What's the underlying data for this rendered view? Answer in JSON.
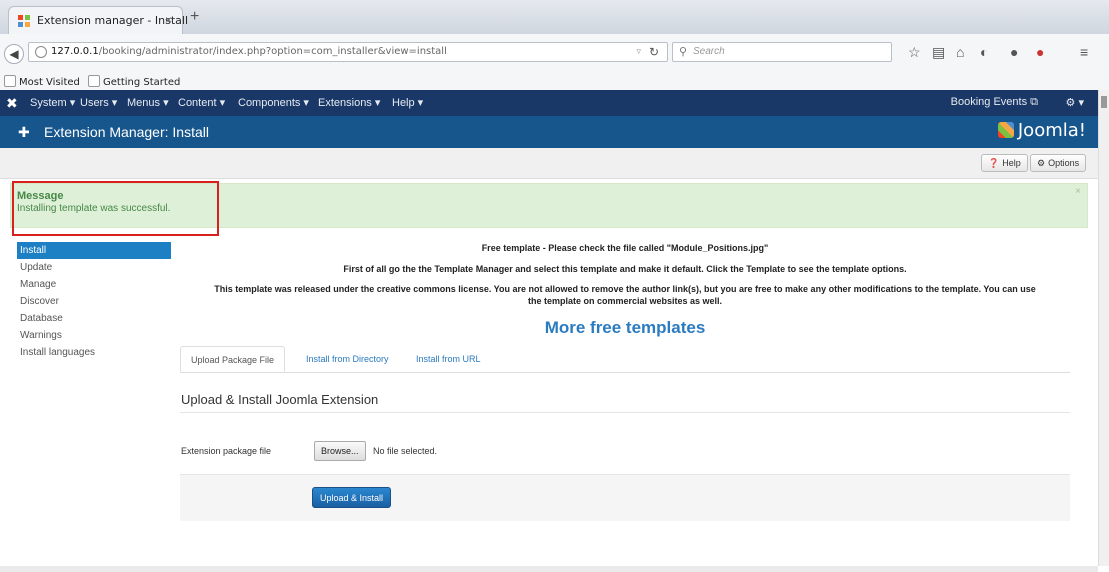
{
  "browser": {
    "tab_title": "Extension manager - Install",
    "tab_close": "×",
    "new_tab": "+",
    "url_host": "127.0.0.1",
    "url_path": "/booking/administrator/index.php?option=com_installer&view=install",
    "search_placeholder": "Search",
    "bookmarks": [
      "Most Visited",
      "Getting Started"
    ]
  },
  "nav": {
    "menu": [
      "System ▾",
      "Users ▾",
      "Menus ▾",
      "Content ▾",
      "Components ▾",
      "Extensions ▾",
      "Help ▾"
    ],
    "site_link": "Booking Events ⧉",
    "settings": "⚙ ▾"
  },
  "header": {
    "title": "Extension Manager: Install",
    "brand": "Joomla!"
  },
  "toolbar": {
    "help_label": "Help",
    "options_label": "Options"
  },
  "alert": {
    "heading": "Message",
    "text": "Installing template was successful.",
    "close": "×"
  },
  "sidebar": {
    "items": [
      "Install",
      "Update",
      "Manage",
      "Discover",
      "Database",
      "Warnings",
      "Install languages"
    ],
    "active_index": 0
  },
  "content": {
    "line1": "Free template - Please check the file called \"Module_Positions.jpg\"",
    "line2": "First of all go the the Template Manager and select this template and make it default. Click the Template to see the template options.",
    "line3a": "This template was released under the creative commons license. You are not allowed to remove the author link(s), but you are free to make any other modifications to the template. You can use",
    "line3b": "the template on commercial websites as well.",
    "more_link": "More free templates",
    "tabs": [
      "Upload Package File",
      "Install from Directory",
      "Install from URL"
    ],
    "section_title": "Upload & Install Joomla Extension",
    "field_label": "Extension package file",
    "browse_label": "Browse...",
    "file_status": "No file selected.",
    "submit_label": "Upload & Install"
  },
  "colors": {
    "nav_bg": "#1a3867",
    "header_bg": "#17568c",
    "alert_bg": "#dff0d8",
    "accent": "#1d7fc4",
    "highlight_border": "#d9201f"
  }
}
